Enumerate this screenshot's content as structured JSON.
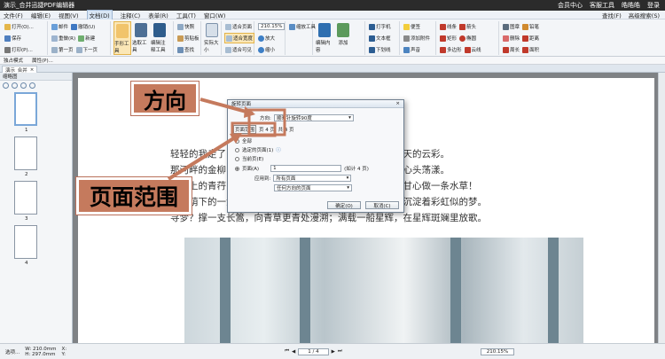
{
  "window": {
    "title": "演示_合并迅捷PDF编辑器",
    "right_items": [
      "会员中心",
      "客服工具",
      "皓皓皓",
      "登录"
    ]
  },
  "menu": {
    "items": [
      "文件(F)",
      "编辑(E)",
      "视图(V)",
      "文档(D)",
      "注释(C)",
      "表单(R)",
      "工具(T)",
      "窗口(W)"
    ],
    "active_index": 3,
    "right_items": [
      "查找(F)",
      "高级搜索(S)"
    ]
  },
  "ribbon": {
    "group1": [
      "打开(O)...",
      "保存",
      "打印(P)...",
      "导出",
      "导入"
    ],
    "group2": [
      "邮件",
      "撤销(U)",
      "重做(R)",
      "新建",
      "第一页",
      "下一页"
    ],
    "big_buttons": [
      "手形工具",
      "选取工具",
      "编辑注释工具"
    ],
    "group3": [
      "快照",
      "剪贴板",
      "查找"
    ],
    "actual_size": "实际大小",
    "group4": [
      "适合页面",
      "适合宽度",
      "适合可见"
    ],
    "zoom_value": "210.15%",
    "group5": [
      "缩放工具",
      "放大",
      "缩小"
    ],
    "group6": [
      "编辑内容",
      "添加",
      "编辑表单"
    ],
    "group7": [
      "打字机",
      "文本框",
      "下划线",
      "标注"
    ],
    "group8": [
      "便签",
      "高亮",
      "添加附件",
      "声音"
    ],
    "group9": [
      "线条",
      "箭头",
      "矩形",
      "椭圆",
      "多边形",
      "多边形线",
      "云线"
    ],
    "group10": [
      "图章",
      "铅笔",
      "删除",
      "距离",
      "周长",
      "面积"
    ]
  },
  "toolbar2": {
    "items": [
      "独占模式",
      "属性(P)..."
    ]
  },
  "tab": {
    "label": "演示_合并",
    "close": "×"
  },
  "sidebar": {
    "title": "缩略图",
    "pages": [
      "1",
      "2",
      "3",
      "4"
    ]
  },
  "document": {
    "lines": [
      "轻轻的我走了，正如我轻轻的来；我轻轻的招手，作别西天的云彩。",
      "那河畔的金柳，是夕阳中的新娘；波光里的艳影，在我的心头荡漾。",
      "软泥上的青荇，油油的在水底招摇；在康河的柔波里，我甘心做一条水草！",
      "那榆荫下的一潭，不是清泉，是天上虹；揉碎在浮藻间，沉淀着彩虹似的梦。",
      "寻梦？撑一支长篙，向青草更青处漫溯；满载一船星辉，在星辉斑斓里放歌。"
    ]
  },
  "dialog": {
    "title": "旋转页面",
    "close": "×",
    "direction_label": "方向:",
    "direction_value": "顺时针旋转90度",
    "range_label": "页面范围",
    "range_info": "页 4 页, 共 4 页",
    "options": [
      "全部",
      "选定的页面(1)",
      "当前页(E)",
      "页面(A)"
    ],
    "pages_value": "1",
    "pages_hint": "(如计 4 页)",
    "apply_label": "应用到:",
    "apply_value": "所有页面",
    "subset_value": "任何方向的页面",
    "ok": "确定(O)",
    "cancel": "取消(C)"
  },
  "status": {
    "left": "选项...",
    "size": "W: 210.0mm\nH: 297.0mm",
    "xy": "X:\nY:",
    "page_box": "1 / 4",
    "zoom": "210.15%"
  },
  "callouts": {
    "direction": "方向",
    "page_range": "页面范围"
  },
  "colors": {
    "callout": "#c57a5d",
    "titlebar": "#2b2b2b"
  }
}
